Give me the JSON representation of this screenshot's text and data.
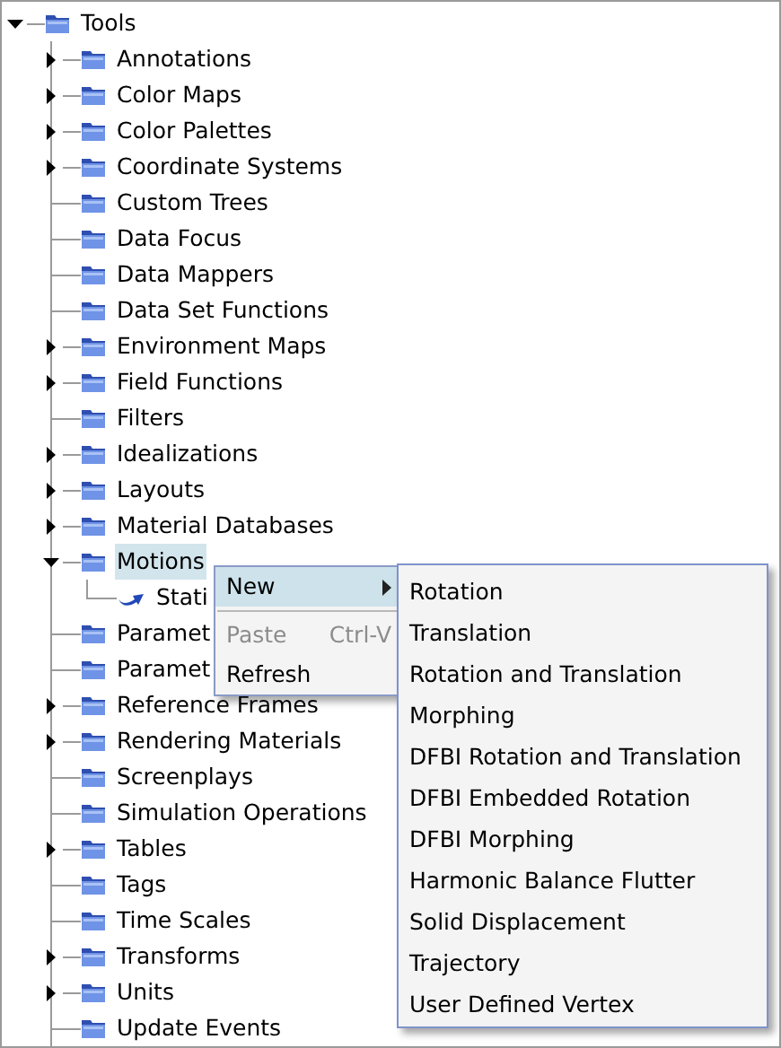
{
  "tree": {
    "label": "Tools",
    "kind": "folder",
    "expandable": true,
    "expanded": true,
    "selected": false,
    "children": [
      {
        "label": "Annotations",
        "kind": "folder",
        "expandable": true,
        "expanded": false,
        "selected": false
      },
      {
        "label": "Color Maps",
        "kind": "folder",
        "expandable": true,
        "expanded": false,
        "selected": false
      },
      {
        "label": "Color Palettes",
        "kind": "folder",
        "expandable": true,
        "expanded": false,
        "selected": false
      },
      {
        "label": "Coordinate Systems",
        "kind": "folder",
        "expandable": true,
        "expanded": false,
        "selected": false
      },
      {
        "label": "Custom Trees",
        "kind": "folder",
        "expandable": false,
        "selected": false
      },
      {
        "label": "Data Focus",
        "kind": "folder",
        "expandable": false,
        "selected": false
      },
      {
        "label": "Data Mappers",
        "kind": "folder",
        "expandable": false,
        "selected": false
      },
      {
        "label": "Data Set Functions",
        "kind": "folder",
        "expandable": false,
        "selected": false
      },
      {
        "label": "Environment Maps",
        "kind": "folder",
        "expandable": true,
        "expanded": false,
        "selected": false
      },
      {
        "label": "Field Functions",
        "kind": "folder",
        "expandable": true,
        "expanded": false,
        "selected": false
      },
      {
        "label": "Filters",
        "kind": "folder",
        "expandable": false,
        "selected": false
      },
      {
        "label": "Idealizations",
        "kind": "folder",
        "expandable": true,
        "expanded": false,
        "selected": false
      },
      {
        "label": "Layouts",
        "kind": "folder",
        "expandable": true,
        "expanded": false,
        "selected": false
      },
      {
        "label": "Material Databases",
        "kind": "folder",
        "expandable": true,
        "expanded": false,
        "selected": false
      },
      {
        "label": "Motions",
        "kind": "folder",
        "expandable": true,
        "expanded": true,
        "selected": true,
        "children": [
          {
            "label": "Stati",
            "kind": "motion",
            "expandable": false,
            "selected": false
          }
        ]
      },
      {
        "label": "Paramet",
        "kind": "folder",
        "expandable": false,
        "selected": false
      },
      {
        "label": "Paramet",
        "kind": "folder",
        "expandable": false,
        "selected": false
      },
      {
        "label": "Reference Frames",
        "kind": "folder",
        "expandable": true,
        "expanded": false,
        "selected": false
      },
      {
        "label": "Rendering Materials",
        "kind": "folder",
        "expandable": true,
        "expanded": false,
        "selected": false
      },
      {
        "label": "Screenplays",
        "kind": "folder",
        "expandable": false,
        "selected": false
      },
      {
        "label": "Simulation Operations",
        "kind": "folder",
        "expandable": false,
        "selected": false
      },
      {
        "label": "Tables",
        "kind": "folder",
        "expandable": true,
        "expanded": false,
        "selected": false
      },
      {
        "label": "Tags",
        "kind": "folder",
        "expandable": false,
        "selected": false
      },
      {
        "label": "Time Scales",
        "kind": "folder",
        "expandable": false,
        "selected": false
      },
      {
        "label": "Transforms",
        "kind": "folder",
        "expandable": true,
        "expanded": false,
        "selected": false
      },
      {
        "label": "Units",
        "kind": "folder",
        "expandable": true,
        "expanded": false,
        "selected": false
      },
      {
        "label": "Update Events",
        "kind": "folder",
        "expandable": false,
        "selected": false
      }
    ]
  },
  "context_menu": {
    "items": [
      {
        "kind": "submenu",
        "label": "New",
        "selected": true,
        "disabled": false
      },
      {
        "kind": "separator"
      },
      {
        "kind": "item",
        "label": "Paste",
        "shortcut": "Ctrl-V",
        "selected": false,
        "disabled": true
      },
      {
        "kind": "item",
        "label": "Refresh",
        "selected": false,
        "disabled": false
      }
    ]
  },
  "submenu": {
    "items": [
      "Rotation",
      "Translation",
      "Rotation and Translation",
      "Morphing",
      "DFBI Rotation and Translation",
      "DFBI Embedded Rotation",
      "DFBI Morphing",
      "Harmonic Balance Flutter",
      "Solid Displacement",
      "Trajectory",
      "User Defined Vertex"
    ]
  }
}
